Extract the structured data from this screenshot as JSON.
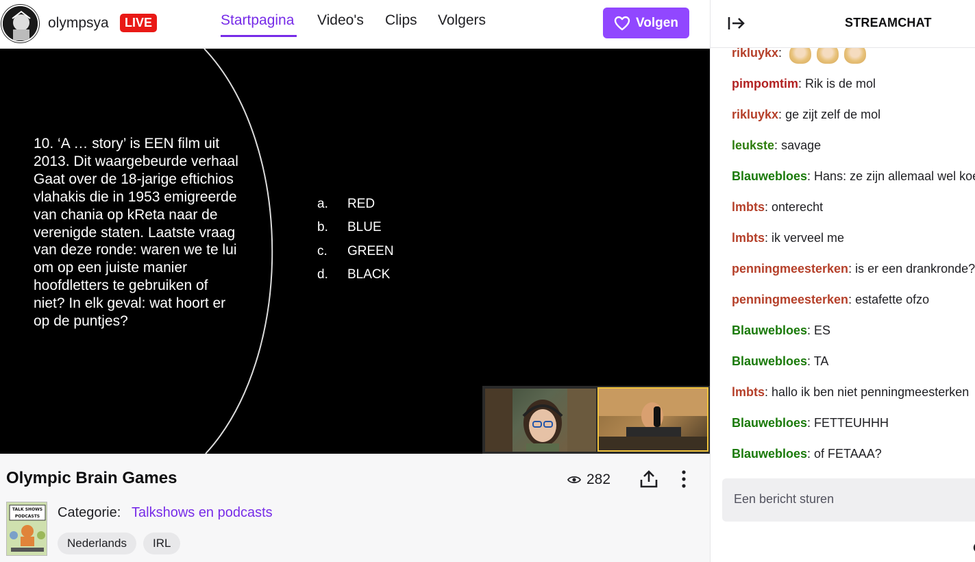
{
  "header": {
    "channel_name": "olympsya",
    "live_label": "LIVE",
    "tabs": [
      {
        "label": "Startpagina",
        "active": true
      },
      {
        "label": "Video's",
        "active": false
      },
      {
        "label": "Clips",
        "active": false
      },
      {
        "label": "Volgers",
        "active": false
      }
    ],
    "follow_label": "Volgen",
    "accent_color": "#9147ff",
    "live_color": "#e91916"
  },
  "video": {
    "question": "10. ‘A … story’ is EEN film uit 2013. Dit waargebeurde verhaal Gaat over de 18-jarige eftichios vlahakis die in 1953 emigreerde van chania op kReta naar de verenigde staten. Laatste vraag van deze ronde: waren we te lui om op een juiste manier hoofdletters te gebruiken of niet? In elk geval: wat hoort er op de puntjes?",
    "answers": [
      {
        "letter": "a.",
        "text": "RED"
      },
      {
        "letter": "b.",
        "text": "BLUE"
      },
      {
        "letter": "c.",
        "text": "GREEN"
      },
      {
        "letter": "d.",
        "text": "BLACK"
      }
    ]
  },
  "info": {
    "title": "Olympic Brain Games",
    "viewers": "282",
    "category_label": "Categorie:",
    "category_name": "Talkshows en podcasts",
    "category_art_text": "TALK SHOWS & PODCASTS",
    "tags": [
      "Nederlands",
      "IRL"
    ]
  },
  "chat": {
    "title": "STREAMCHAT",
    "input_placeholder": "Een bericht sturen",
    "messages": [
      {
        "user": "rikluykx",
        "sep": ":",
        "text": "",
        "color": "#b5402a",
        "emotes": 3
      },
      {
        "user": "pimpomtim",
        "sep": ":",
        "text": " Rik is de mol",
        "color": "#b22222"
      },
      {
        "user": "rikluykx",
        "sep": ":",
        "text": " ge zijt zelf de mol",
        "color": "#b5402a"
      },
      {
        "user": "leukste",
        "sep": ":",
        "text": " savage",
        "color": "#2e7d0e"
      },
      {
        "user": "Blauwebloes",
        "sep": ":",
        "text": " Hans: ze zijn allemaal wel koel",
        "color": "#1a7a0a"
      },
      {
        "user": "lmbts",
        "sep": ":",
        "text": " onterecht",
        "color": "#b5402a"
      },
      {
        "user": "lmbts",
        "sep": ":",
        "text": " ik verveel me",
        "color": "#b5402a"
      },
      {
        "user": "penningmeesterken",
        "sep": ":",
        "text": " is er een drankronde?",
        "color": "#b5402a"
      },
      {
        "user": "penningmeesterken",
        "sep": ":",
        "text": " estafette ofzo",
        "color": "#b5402a"
      },
      {
        "user": "Blauwebloes",
        "sep": ":",
        "text": " ES",
        "color": "#1a7a0a"
      },
      {
        "user": "Blauwebloes",
        "sep": ":",
        "text": " TA",
        "color": "#1a7a0a"
      },
      {
        "user": "lmbts",
        "sep": ":",
        "text": " hallo ik ben niet penningmeesterken",
        "color": "#b5402a"
      },
      {
        "user": "Blauwebloes",
        "sep": ":",
        "text": " FETTEUHHH",
        "color": "#1a7a0a"
      },
      {
        "user": "Blauwebloes",
        "sep": ":",
        "text": " of FETAAA?",
        "color": "#1a7a0a"
      }
    ]
  }
}
